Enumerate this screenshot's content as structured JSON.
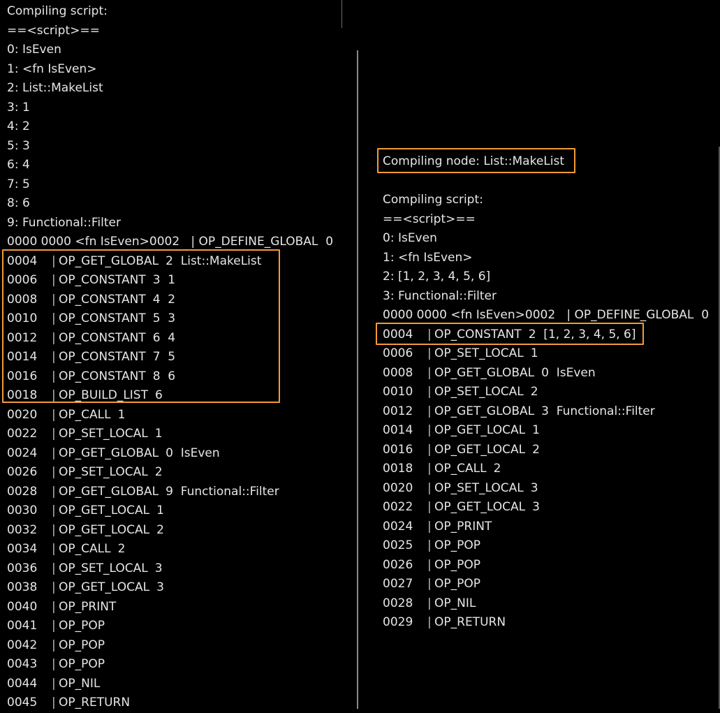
{
  "left": {
    "header": "Compiling script:",
    "script_marker": "==<script>==",
    "constants": [
      "0: IsEven",
      "1: <fn IsEven>",
      "2: List::MakeList",
      "3: 1",
      "4: 2",
      "5: 3",
      "6: 4",
      "7: 5",
      "8: 6",
      "9: Functional::Filter"
    ],
    "define_line": "0000 0000 <fn IsEven>0002   | OP_DEFINE_GLOBAL  0",
    "instructions": [
      {
        "offset": "0004",
        "op": "OP_GET_GLOBAL",
        "args": "2  List::MakeList"
      },
      {
        "offset": "0006",
        "op": "OP_CONSTANT",
        "args": "3  1"
      },
      {
        "offset": "0008",
        "op": "OP_CONSTANT",
        "args": "4  2"
      },
      {
        "offset": "0010",
        "op": "OP_CONSTANT",
        "args": "5  3"
      },
      {
        "offset": "0012",
        "op": "OP_CONSTANT",
        "args": "6  4"
      },
      {
        "offset": "0014",
        "op": "OP_CONSTANT",
        "args": "7  5"
      },
      {
        "offset": "0016",
        "op": "OP_CONSTANT",
        "args": "8  6"
      },
      {
        "offset": "0018",
        "op": "OP_BUILD_LIST",
        "args": "6"
      },
      {
        "offset": "0020",
        "op": "OP_CALL",
        "args": "1"
      },
      {
        "offset": "0022",
        "op": "OP_SET_LOCAL",
        "args": "1"
      },
      {
        "offset": "0024",
        "op": "OP_GET_GLOBAL",
        "args": "0  IsEven"
      },
      {
        "offset": "0026",
        "op": "OP_SET_LOCAL",
        "args": "2"
      },
      {
        "offset": "0028",
        "op": "OP_GET_GLOBAL",
        "args": "9  Functional::Filter"
      },
      {
        "offset": "0030",
        "op": "OP_GET_LOCAL",
        "args": "1"
      },
      {
        "offset": "0032",
        "op": "OP_GET_LOCAL",
        "args": "2"
      },
      {
        "offset": "0034",
        "op": "OP_CALL",
        "args": "2"
      },
      {
        "offset": "0036",
        "op": "OP_SET_LOCAL",
        "args": "3"
      },
      {
        "offset": "0038",
        "op": "OP_GET_LOCAL",
        "args": "3"
      },
      {
        "offset": "0040",
        "op": "OP_PRINT",
        "args": ""
      },
      {
        "offset": "0041",
        "op": "OP_POP",
        "args": ""
      },
      {
        "offset": "0042",
        "op": "OP_POP",
        "args": ""
      },
      {
        "offset": "0043",
        "op": "OP_POP",
        "args": ""
      },
      {
        "offset": "0044",
        "op": "OP_NIL",
        "args": ""
      },
      {
        "offset": "0045",
        "op": "OP_RETURN",
        "args": ""
      }
    ]
  },
  "right": {
    "node_header": "Compiling node: List::MakeList",
    "header": "Compiling script:",
    "script_marker": "==<script>==",
    "constants": [
      "0: IsEven",
      "1: <fn IsEven>",
      "2: [1, 2, 3, 4, 5, 6]",
      "3: Functional::Filter"
    ],
    "define_line": "0000 0000 <fn IsEven>0002   | OP_DEFINE_GLOBAL  0",
    "instructions": [
      {
        "offset": "0004",
        "op": "OP_CONSTANT",
        "args": "2  [1, 2, 3, 4, 5, 6]"
      },
      {
        "offset": "0006",
        "op": "OP_SET_LOCAL",
        "args": "1"
      },
      {
        "offset": "0008",
        "op": "OP_GET_GLOBAL",
        "args": "0  IsEven"
      },
      {
        "offset": "0010",
        "op": "OP_SET_LOCAL",
        "args": "2"
      },
      {
        "offset": "0012",
        "op": "OP_GET_GLOBAL",
        "args": "3  Functional::Filter"
      },
      {
        "offset": "0014",
        "op": "OP_GET_LOCAL",
        "args": "1"
      },
      {
        "offset": "0016",
        "op": "OP_GET_LOCAL",
        "args": "2"
      },
      {
        "offset": "0018",
        "op": "OP_CALL",
        "args": "2"
      },
      {
        "offset": "0020",
        "op": "OP_SET_LOCAL",
        "args": "3"
      },
      {
        "offset": "0022",
        "op": "OP_GET_LOCAL",
        "args": "3"
      },
      {
        "offset": "0024",
        "op": "OP_PRINT",
        "args": ""
      },
      {
        "offset": "0025",
        "op": "OP_POP",
        "args": ""
      },
      {
        "offset": "0026",
        "op": "OP_POP",
        "args": ""
      },
      {
        "offset": "0027",
        "op": "OP_POP",
        "args": ""
      },
      {
        "offset": "0028",
        "op": "OP_NIL",
        "args": ""
      },
      {
        "offset": "0029",
        "op": "OP_RETURN",
        "args": ""
      }
    ]
  },
  "highlight_color": "#f39a3a"
}
